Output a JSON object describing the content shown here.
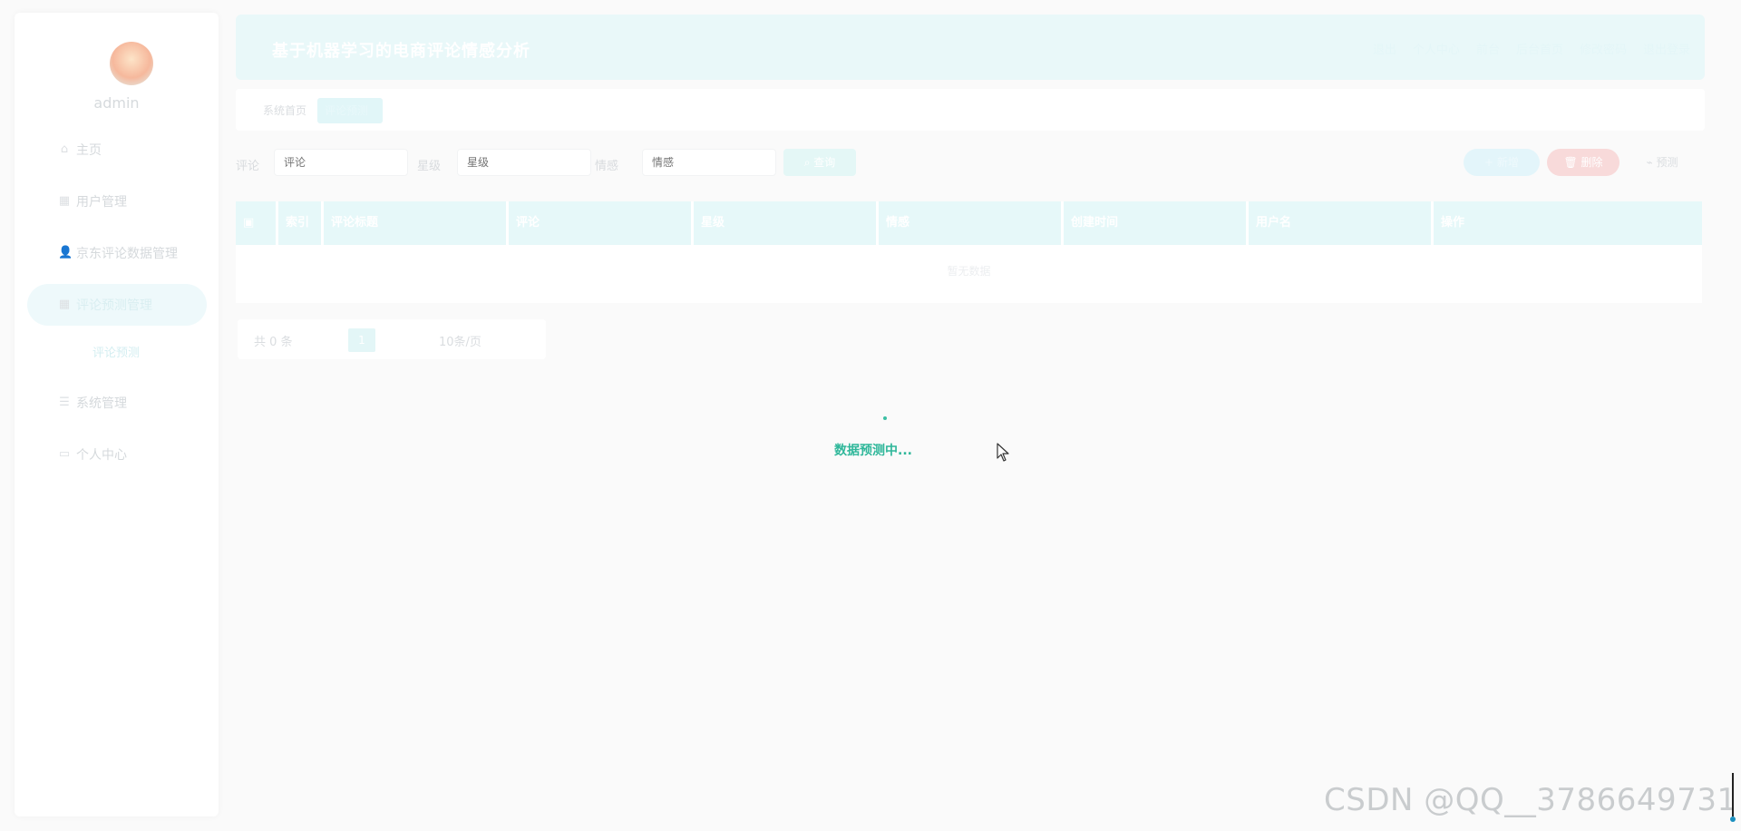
{
  "sidebar": {
    "username": "admin",
    "items": [
      {
        "label": "主页",
        "icon": "home-icon"
      },
      {
        "label": "用户管理",
        "icon": "grid-icon"
      },
      {
        "label": "京东评论数据管理",
        "icon": "user-icon"
      },
      {
        "label": "评论预测管理",
        "icon": "grid-icon"
      },
      {
        "label": "系统管理",
        "icon": "list-icon"
      },
      {
        "label": "个人中心",
        "icon": "card-icon"
      }
    ],
    "submenu_label": "评论预测"
  },
  "header": {
    "title": "基于机器学习的电商评论情感分析",
    "links": [
      "退出",
      "个人中心",
      "前台",
      "后台首页",
      "修改密码",
      "退出登录"
    ]
  },
  "tabs": [
    {
      "label": "系统首页"
    },
    {
      "label": "评论预测"
    }
  ],
  "search": {
    "field1_label": "评论",
    "field1_placeholder": "评论",
    "field2_label": "星级",
    "field2_placeholder": "星级",
    "field3_label": "情感",
    "field3_placeholder": "情感",
    "search_label": "查询",
    "add_label": "新增",
    "delete_label": "删除",
    "predict_label": "预测"
  },
  "table": {
    "columns": [
      "",
      "索引",
      "评论标题",
      "评论",
      "星级",
      "情感",
      "创建时间",
      "用户名",
      "操作"
    ],
    "empty_text": "暂无数据"
  },
  "pagination": {
    "total_text": "共 0 条",
    "current_page": "1",
    "page_size_text": "10条/页"
  },
  "loading": {
    "text": "数据预测中..."
  },
  "watermark": "CSDN @QQ__3786649731",
  "colors": {
    "accent": "#2fb79a",
    "header_bg": "#e9f8f9",
    "delete": "#f8dada"
  }
}
